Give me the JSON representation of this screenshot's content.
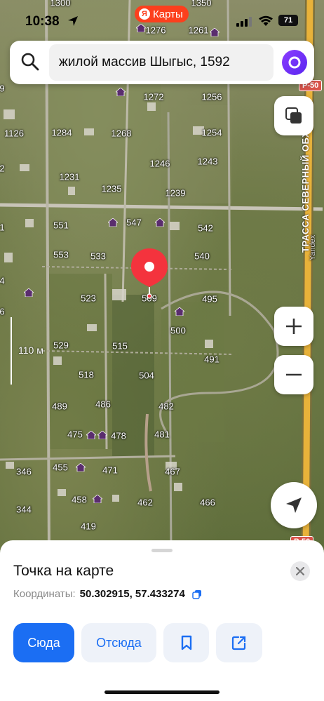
{
  "status_bar": {
    "time": "10:38",
    "app_badge_letter": "Я",
    "app_badge": "Карты",
    "battery": "71"
  },
  "search": {
    "query": "жилой массив Шыгыс, 1592"
  },
  "map": {
    "road_badges": [
      "Р-50",
      "Р-50"
    ],
    "road_name": "ТРАССА СЕВЕРНЫЙ ОБХОД",
    "watermark": "Yandex",
    "scale_label": "110 м",
    "lot_numbers": [
      "1300",
      "1350",
      "1276",
      "1261",
      "9",
      "1272",
      "1256",
      "1126",
      "1284",
      "1268",
      "1254",
      "1246",
      "1243",
      "2",
      "1231",
      "1235",
      "1239",
      "1",
      "551",
      "547",
      "542",
      "553",
      "533",
      "540",
      "4",
      "523",
      "509",
      "495",
      "6",
      "500",
      "529",
      "515",
      "491",
      "518",
      "504",
      "489",
      "486",
      "482",
      "475",
      "478",
      "481",
      "346",
      "455",
      "471",
      "467",
      "344",
      "458",
      "462",
      "466",
      "419"
    ]
  },
  "sheet": {
    "title": "Точка на карте",
    "coords_label": "Координаты:",
    "coords_value": "50.302915, 57.433274",
    "buttons": {
      "here": "Сюда",
      "from": "Отсюда"
    }
  },
  "colors": {
    "accent": "#1b6ef3",
    "pin": "#f4333d",
    "brand": "#fc3f1d",
    "road": "#e8b23a"
  }
}
